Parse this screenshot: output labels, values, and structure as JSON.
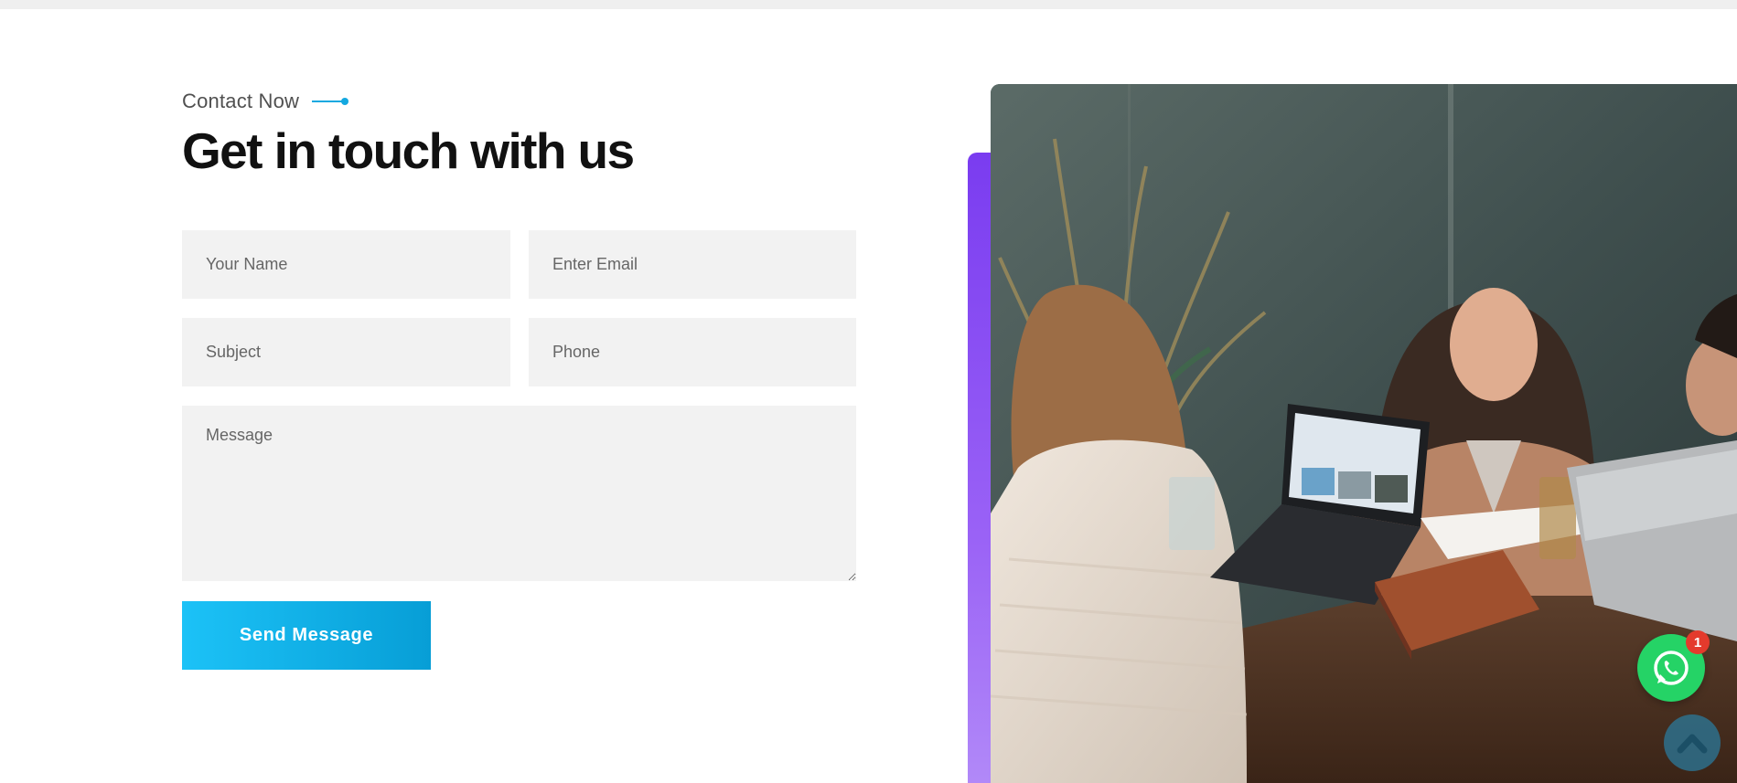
{
  "section": {
    "kicker": "Contact Now",
    "heading": "Get in touch with us"
  },
  "form": {
    "name_placeholder": "Your Name",
    "email_placeholder": "Enter Email",
    "subject_placeholder": "Subject",
    "phone_placeholder": "Phone",
    "message_placeholder": "Message",
    "submit_label": "Send Message"
  },
  "image": {
    "alt": "People working at a table with laptops"
  },
  "widgets": {
    "whatsapp_icon": "whatsapp-icon",
    "whatsapp_badge": "1",
    "back_to_top_icon": "chevron-up-icon"
  },
  "colors": {
    "accent": "#14a8e0",
    "button_start": "#1cc2f7",
    "button_end": "#079ed6",
    "purple": "#7a3cf0",
    "whatsapp": "#25d366",
    "badge": "#e43a2c"
  }
}
